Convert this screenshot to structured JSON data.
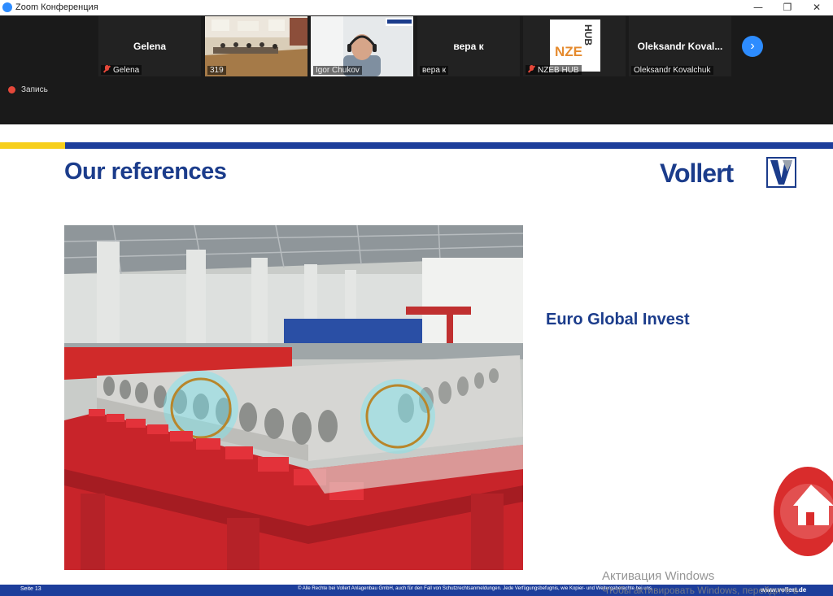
{
  "window": {
    "title": "Zoom Конференция",
    "minimize_glyph": "—",
    "maximize_glyph": "❐",
    "close_glyph": "✕"
  },
  "recording": {
    "label": "Запись",
    "color": "#e5483a"
  },
  "participants": [
    {
      "big_label": "Gelena",
      "name": "Gelena",
      "muted": true
    },
    {
      "big_label": "",
      "name": "319",
      "muted": false
    },
    {
      "big_label": "",
      "name": "Igor Chukov",
      "muted": false,
      "active": true
    },
    {
      "big_label": "вера к",
      "name": "вера к",
      "muted": false
    },
    {
      "big_label": "",
      "name": "NZEB HUB",
      "muted": true,
      "logo_text_1": "NZE",
      "logo_text_2": "HUB"
    },
    {
      "big_label": "Oleksandr  Koval...",
      "name": "Oleksandr Kovalchuk",
      "muted": false
    }
  ],
  "next_button": {
    "glyph": "›"
  },
  "slide": {
    "title": "Our references",
    "logo_text": "Vollert",
    "logo_mark": "V",
    "company": "Euro Global Invest",
    "footer_left": "Seite 13",
    "footer_center": "© Alle Rechte bei Vollert Anlagenbau GmbH, auch für den Fall von Schutzrechtsanmeldungen. Jede Verfügungsbefugnis, wie Kopier- und Weitergaberechte bei uns.",
    "footer_right": "www.vollert.de"
  },
  "watermark": {
    "line1": "Активация Windows",
    "line2": "Чтобы активировать Windows, перейдите в"
  },
  "colors": {
    "brand_blue": "#1b3c8b",
    "stripe_yellow": "#f7cf1b",
    "stripe_blue": "#1d3e9b",
    "zoom_blue": "#2d8cff",
    "active_border": "#7ec13c",
    "home_red": "#d92c2c"
  },
  "icons": [
    "zoom-app-icon",
    "record-icon",
    "mic-muted-icon",
    "chevron-right-icon",
    "home-icon"
  ]
}
